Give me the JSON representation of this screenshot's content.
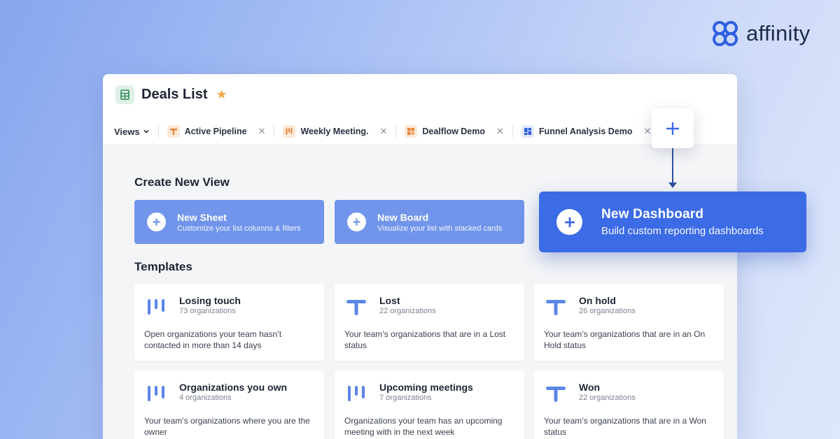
{
  "brand": {
    "name": "affinity",
    "color": "#2f5fe0"
  },
  "list": {
    "title": "Deals List",
    "icon": "table-icon"
  },
  "views": {
    "label": "Views",
    "tabs": [
      {
        "label": "Active Pipeline",
        "icon": "pipeline-icon"
      },
      {
        "label": "Weekly Meeting.",
        "icon": "board-icon"
      },
      {
        "label": "Dealflow Demo",
        "icon": "grid-icon"
      },
      {
        "label": "Funnel Analysis Demo",
        "icon": "dashboard-icon"
      }
    ]
  },
  "create": {
    "heading": "Create New View",
    "options": [
      {
        "title": "New Sheet",
        "subtitle": "Customize your list columns & filters"
      },
      {
        "title": "New Board",
        "subtitle": "Visualize your list with stacked cards"
      },
      {
        "title": "New Dashboard",
        "subtitle": "Build custom reporting dashboards"
      }
    ]
  },
  "templates": {
    "heading": "Templates",
    "items": [
      {
        "name": "Losing touch",
        "count": "73 organizations",
        "desc": "Open organizations your team hasn’t contacted in more than 14 days",
        "icon": "board-icon"
      },
      {
        "name": "Lost",
        "count": "22 organizations",
        "desc": "Your team’s organizations that are in a Lost status",
        "icon": "sheet-icon"
      },
      {
        "name": "On hold",
        "count": "26 organizations",
        "desc": "Your team’s organizations that are in an On Hold status",
        "icon": "sheet-icon"
      },
      {
        "name": "Organizations you own",
        "count": "4 organizations",
        "desc": "Your team’s organizations where you are the owner",
        "icon": "board-icon"
      },
      {
        "name": "Upcoming meetings",
        "count": "7 organizations",
        "desc": "Organizations your team has an upcoming meeting with in the next week",
        "icon": "board-icon"
      },
      {
        "name": "Won",
        "count": "22 organizations",
        "desc": "Your team’s organizations that are in a Won status",
        "icon": "sheet-icon"
      }
    ]
  },
  "colors": {
    "accent": "#3c6be6",
    "card": "#7095ea",
    "template_icon": "#5b86e8"
  }
}
